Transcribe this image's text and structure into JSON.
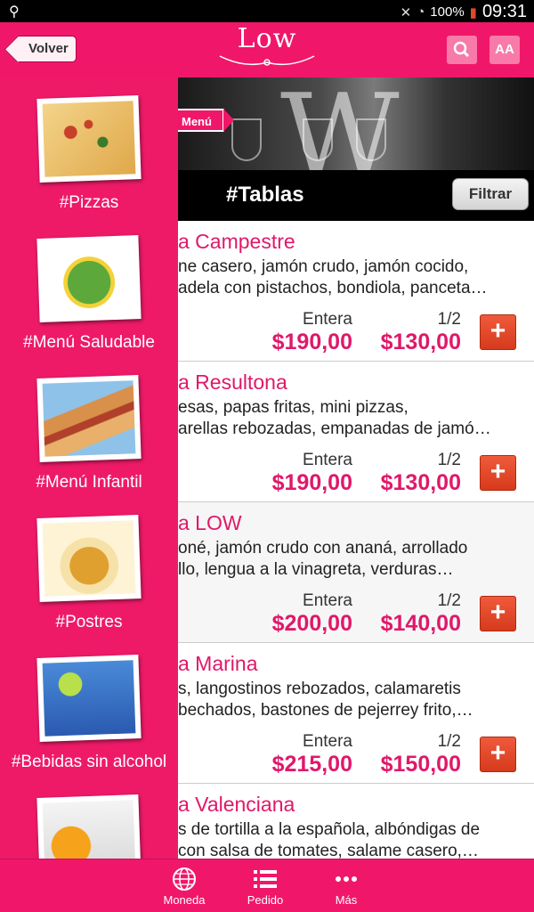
{
  "status_bar": {
    "battery": "100%",
    "time": "09:31"
  },
  "header": {
    "back_label": "Volver",
    "logo_text": "Low",
    "font_size_label": "AA"
  },
  "banner": {
    "menu_tag": "Menú"
  },
  "section": {
    "title": "#Tablas",
    "filter_label": "Filtrar"
  },
  "sidebar": {
    "items": [
      {
        "label": "#Pizzas"
      },
      {
        "label": "#Menú Saludable"
      },
      {
        "label": "#Menú Infantil"
      },
      {
        "label": "#Postres"
      },
      {
        "label": "#Bebidas sin alcohol"
      },
      {
        "label": ""
      }
    ]
  },
  "price_headers": {
    "full": "Entera",
    "half": "1/2"
  },
  "products": [
    {
      "name": "a Campestre",
      "desc1": "ne casero, jamón crudo, jamón cocido,",
      "desc2": "adela con pistachos, bondiola, panceta…",
      "price_full": "$190,00",
      "price_half": "$130,00"
    },
    {
      "name": "a Resultona",
      "desc1": "esas, papas fritas, mini pizzas,",
      "desc2": "arellas rebozadas, empanadas de jamó…",
      "price_full": "$190,00",
      "price_half": "$130,00"
    },
    {
      "name": "a LOW",
      "desc1": "oné, jamón crudo con ananá, arrollado",
      "desc2": "llo, lengua a la vinagreta, verduras…",
      "price_full": "$200,00",
      "price_half": "$140,00"
    },
    {
      "name": "a Marina",
      "desc1": "s, langostinos rebozados, calamaretis",
      "desc2": "bechados, bastones de pejerrey frito,…",
      "price_full": "$215,00",
      "price_half": "$150,00"
    },
    {
      "name": "a Valenciana",
      "desc1": "s de tortilla a la española, albóndigas de",
      "desc2": "con salsa de tomates, salame casero,…",
      "price_full": "",
      "price_half": ""
    }
  ],
  "add_label": "+",
  "bottom_tabs": [
    {
      "label": "Moneda",
      "icon": "globe-dollar-icon"
    },
    {
      "label": "Pedido",
      "icon": "list-icon"
    },
    {
      "label": "Más",
      "icon": "more-dots-icon"
    }
  ],
  "colors": {
    "brand": "#f0176a",
    "accent_red": "#e04a2c"
  }
}
